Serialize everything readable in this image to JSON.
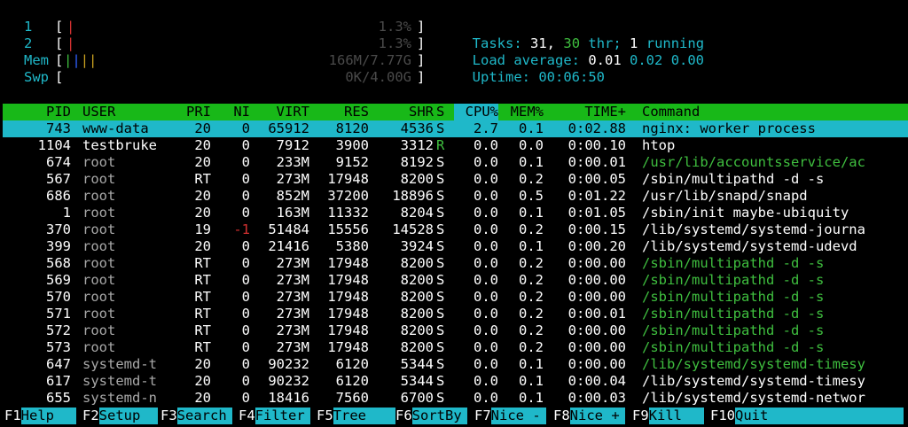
{
  "meters": {
    "cpu1": {
      "label": "1",
      "value": "1.3%",
      "level": 0.013
    },
    "cpu2": {
      "label": "2",
      "value": "1.3%",
      "level": 0.013
    },
    "mem": {
      "label": "Mem",
      "value": "166M/7.77G",
      "level": 0.021
    },
    "swp": {
      "label": "Swp",
      "value": "0K/4.00G",
      "level": 0
    }
  },
  "summary": {
    "tasks_label": "Tasks:",
    "tasks_count": "31,",
    "threads": "30",
    "thr_label": "thr;",
    "running_count": "1",
    "running_label": "running",
    "load_label": "Load average:",
    "load1": "0.01",
    "load5": "0.02",
    "load15": "0.00",
    "uptime_label": "Uptime:",
    "uptime": "00:06:50"
  },
  "columns": [
    "PID",
    "USER",
    "PRI",
    "NI",
    "VIRT",
    "RES",
    "SHR",
    "S",
    "CPU%",
    "MEM%",
    "TIME+",
    "Command"
  ],
  "processes": [
    {
      "pid": "743",
      "user": "www-data",
      "pri": "20",
      "ni": "0",
      "virt": "65912",
      "res": "8120",
      "shr": "4536",
      "s": "S",
      "cpu": "2.7",
      "mem": "0.1",
      "time": "0:02.88",
      "cmd": "nginx: worker process"
    },
    {
      "pid": "1104",
      "user": "testbruke",
      "pri": "20",
      "ni": "0",
      "virt": "7912",
      "res": "3900",
      "shr": "3312",
      "s": "R",
      "cpu": "0.0",
      "mem": "0.0",
      "time": "0:00.10",
      "cmd": "htop"
    },
    {
      "pid": "674",
      "user": "root",
      "pri": "20",
      "ni": "0",
      "virt": "233M",
      "res": "9152",
      "shr": "8192",
      "s": "S",
      "cpu": "0.0",
      "mem": "0.1",
      "time": "0:00.01",
      "cmd": "/usr/lib/accountsservice/ac"
    },
    {
      "pid": "567",
      "user": "root",
      "pri": "RT",
      "ni": "0",
      "virt": "273M",
      "res": "17948",
      "shr": "8200",
      "s": "S",
      "cpu": "0.0",
      "mem": "0.2",
      "time": "0:00.05",
      "cmd": "/sbin/multipathd -d -s"
    },
    {
      "pid": "686",
      "user": "root",
      "pri": "20",
      "ni": "0",
      "virt": "852M",
      "res": "37200",
      "shr": "18896",
      "s": "S",
      "cpu": "0.0",
      "mem": "0.5",
      "time": "0:01.22",
      "cmd": "/usr/lib/snapd/snapd"
    },
    {
      "pid": "1",
      "user": "root",
      "pri": "20",
      "ni": "0",
      "virt": "163M",
      "res": "11332",
      "shr": "8204",
      "s": "S",
      "cpu": "0.0",
      "mem": "0.1",
      "time": "0:01.05",
      "cmd": "/sbin/init maybe-ubiquity"
    },
    {
      "pid": "370",
      "user": "root",
      "pri": "19",
      "ni": "-1",
      "virt": "51484",
      "res": "15556",
      "shr": "14528",
      "s": "S",
      "cpu": "0.0",
      "mem": "0.2",
      "time": "0:00.15",
      "cmd": "/lib/systemd/systemd-journa"
    },
    {
      "pid": "399",
      "user": "root",
      "pri": "20",
      "ni": "0",
      "virt": "21416",
      "res": "5380",
      "shr": "3924",
      "s": "S",
      "cpu": "0.0",
      "mem": "0.1",
      "time": "0:00.20",
      "cmd": "/lib/systemd/systemd-udevd"
    },
    {
      "pid": "568",
      "user": "root",
      "pri": "RT",
      "ni": "0",
      "virt": "273M",
      "res": "17948",
      "shr": "8200",
      "s": "S",
      "cpu": "0.0",
      "mem": "0.2",
      "time": "0:00.00",
      "cmd": "/sbin/multipathd -d -s"
    },
    {
      "pid": "569",
      "user": "root",
      "pri": "RT",
      "ni": "0",
      "virt": "273M",
      "res": "17948",
      "shr": "8200",
      "s": "S",
      "cpu": "0.0",
      "mem": "0.2",
      "time": "0:00.00",
      "cmd": "/sbin/multipathd -d -s"
    },
    {
      "pid": "570",
      "user": "root",
      "pri": "RT",
      "ni": "0",
      "virt": "273M",
      "res": "17948",
      "shr": "8200",
      "s": "S",
      "cpu": "0.0",
      "mem": "0.2",
      "time": "0:00.00",
      "cmd": "/sbin/multipathd -d -s"
    },
    {
      "pid": "571",
      "user": "root",
      "pri": "RT",
      "ni": "0",
      "virt": "273M",
      "res": "17948",
      "shr": "8200",
      "s": "S",
      "cpu": "0.0",
      "mem": "0.2",
      "time": "0:00.01",
      "cmd": "/sbin/multipathd -d -s"
    },
    {
      "pid": "572",
      "user": "root",
      "pri": "RT",
      "ni": "0",
      "virt": "273M",
      "res": "17948",
      "shr": "8200",
      "s": "S",
      "cpu": "0.0",
      "mem": "0.2",
      "time": "0:00.00",
      "cmd": "/sbin/multipathd -d -s"
    },
    {
      "pid": "573",
      "user": "root",
      "pri": "RT",
      "ni": "0",
      "virt": "273M",
      "res": "17948",
      "shr": "8200",
      "s": "S",
      "cpu": "0.0",
      "mem": "0.2",
      "time": "0:00.00",
      "cmd": "/sbin/multipathd -d -s"
    },
    {
      "pid": "647",
      "user": "systemd-t",
      "pri": "20",
      "ni": "0",
      "virt": "90232",
      "res": "6120",
      "shr": "5344",
      "s": "S",
      "cpu": "0.0",
      "mem": "0.1",
      "time": "0:00.00",
      "cmd": "/lib/systemd/systemd-timesy"
    },
    {
      "pid": "617",
      "user": "systemd-t",
      "pri": "20",
      "ni": "0",
      "virt": "90232",
      "res": "6120",
      "shr": "5344",
      "s": "S",
      "cpu": "0.0",
      "mem": "0.1",
      "time": "0:00.04",
      "cmd": "/lib/systemd/systemd-timesy"
    },
    {
      "pid": "655",
      "user": "systemd-n",
      "pri": "20",
      "ni": "0",
      "virt": "18416",
      "res": "7560",
      "shr": "6700",
      "s": "S",
      "cpu": "0.0",
      "mem": "0.1",
      "time": "0:00.03",
      "cmd": "/lib/systemd/systemd-networ"
    }
  ],
  "function_keys": [
    {
      "key": "F1",
      "label": "Help"
    },
    {
      "key": "F2",
      "label": "Setup"
    },
    {
      "key": "F3",
      "label": "Search"
    },
    {
      "key": "F4",
      "label": "Filter"
    },
    {
      "key": "F5",
      "label": "Tree"
    },
    {
      "key": "F6",
      "label": "SortBy"
    },
    {
      "key": "F7",
      "label": "Nice -"
    },
    {
      "key": "F8",
      "label": "Nice +"
    },
    {
      "key": "F9",
      "label": "Kill"
    },
    {
      "key": "F10",
      "label": "Quit"
    }
  ],
  "colors": {
    "cyan": "#1fb8c9",
    "green": "#18b818",
    "red": "#d03030"
  }
}
